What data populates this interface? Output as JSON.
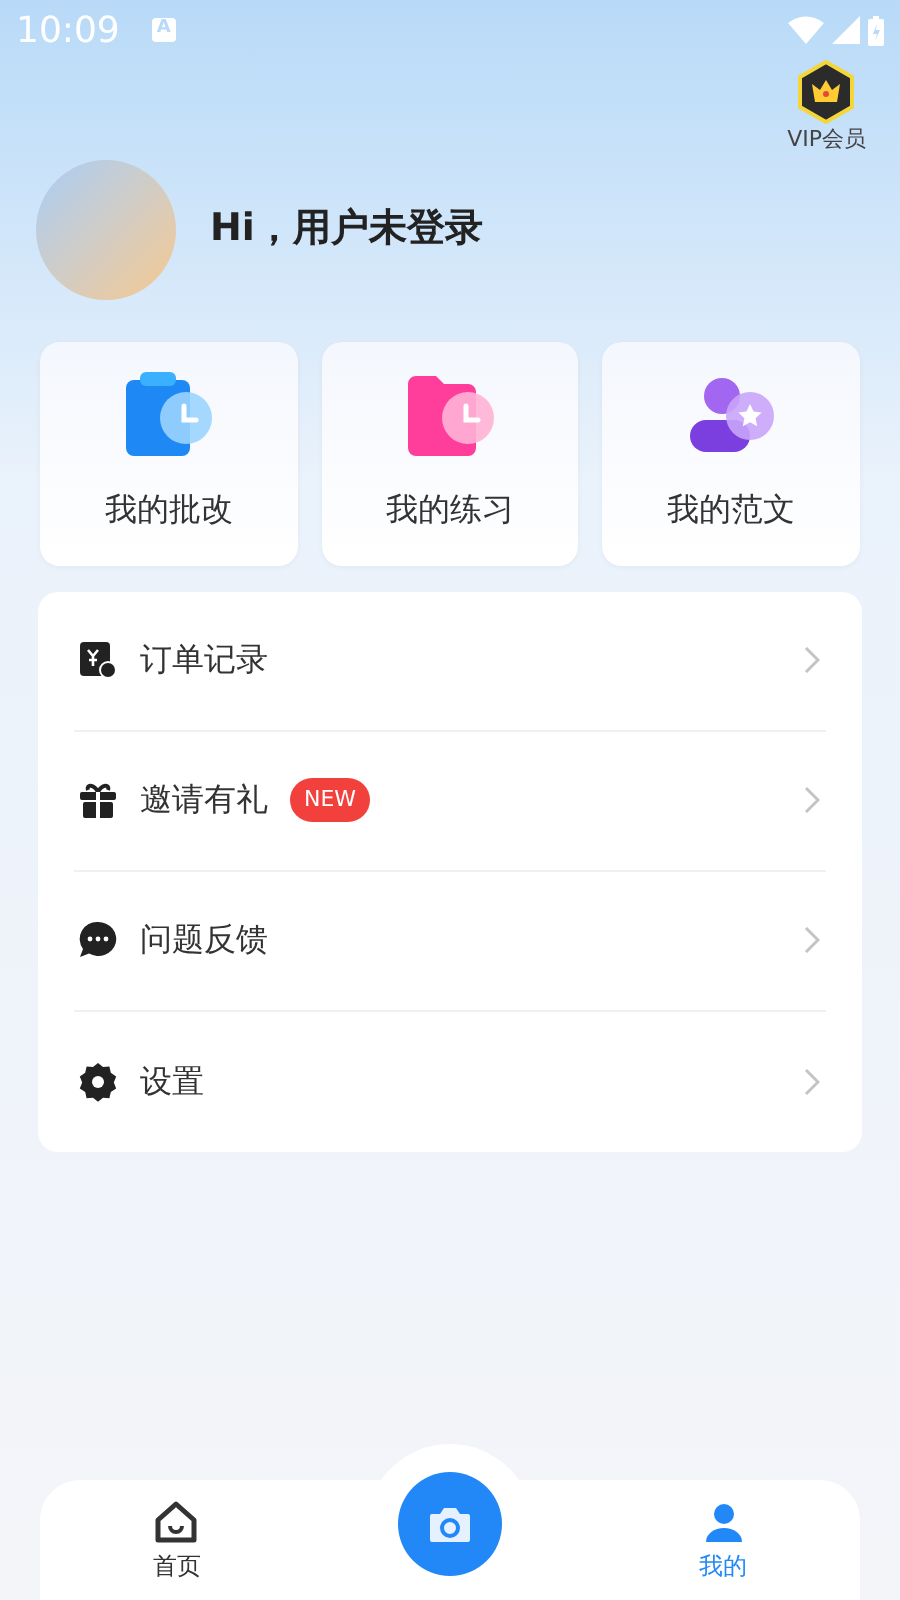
{
  "status_bar": {
    "time": "10:09",
    "notification": "A"
  },
  "vip": {
    "label": "VIP会员"
  },
  "profile": {
    "greeting": "Hi，用户未登录"
  },
  "shortcuts": [
    {
      "kind": "review",
      "label": "我的批改"
    },
    {
      "kind": "practice",
      "label": "我的练习"
    },
    {
      "kind": "essay",
      "label": "我的范文"
    }
  ],
  "menu": [
    {
      "kind": "orders",
      "label": "订单记录"
    },
    {
      "kind": "gift",
      "label": "邀请有礼",
      "badge": "NEW"
    },
    {
      "kind": "feedback",
      "label": "问题反馈"
    },
    {
      "kind": "settings",
      "label": "设置"
    }
  ],
  "bottom_nav": [
    {
      "kind": "home",
      "label": "首页",
      "selected": false
    },
    {
      "kind": "camera",
      "selected": false
    },
    {
      "kind": "mine",
      "label": "我的",
      "selected": true
    }
  ]
}
